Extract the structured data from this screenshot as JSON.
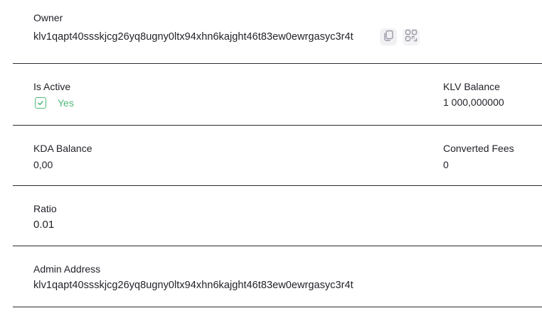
{
  "owner": {
    "label": "Owner",
    "address": "klv1qapt40ssskjcg26yq8ugny0ltx94xhn6kajght46t83ew0ewrgasyc3r4t",
    "copy_icon": "copy-icon",
    "qr_icon": "qr-code-icon"
  },
  "is_active": {
    "label": "Is Active",
    "value": "Yes",
    "icon": "checkbox-checked-icon"
  },
  "klv_balance": {
    "label": "KLV Balance",
    "value": "1 000,000000"
  },
  "kda_balance": {
    "label": "KDA Balance",
    "value": "0,00"
  },
  "converted_fees": {
    "label": "Converted Fees",
    "value": "0"
  },
  "ratio": {
    "label": "Ratio",
    "value": "0.01"
  },
  "admin_address": {
    "label": "Admin Address",
    "value": "klv1qapt40ssskjcg26yq8ugny0ltx94xhn6kajght46t83ew0ewrgasyc3r4t"
  },
  "colors": {
    "active_green": "#4fb97a",
    "text": "#22222a",
    "divider": "#2b2b33"
  }
}
